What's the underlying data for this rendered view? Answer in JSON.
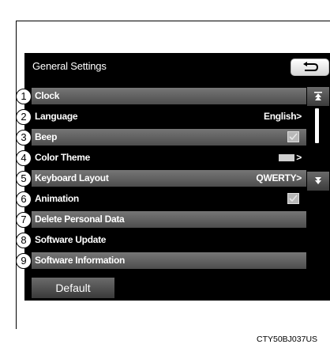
{
  "screen": {
    "title": "General Settings",
    "back_icon": "return-arrow-icon"
  },
  "items": [
    {
      "number": "1",
      "label": "Clock",
      "value": "",
      "highlighted": true
    },
    {
      "number": "2",
      "label": "Language",
      "value": "English",
      "value_suffix": ">",
      "highlighted": false
    },
    {
      "number": "3",
      "label": "Beep",
      "checked": true,
      "highlighted": true
    },
    {
      "number": "4",
      "label": "Color Theme",
      "value_suffix": ">",
      "swatch_color": "#cfcfcf",
      "highlighted": false
    },
    {
      "number": "5",
      "label": "Keyboard Layout",
      "value": "QWERTY",
      "value_suffix": ">",
      "highlighted": true
    },
    {
      "number": "6",
      "label": "Animation",
      "checked": true,
      "highlighted": false
    },
    {
      "number": "7",
      "label": "Delete Personal Data",
      "highlighted": true
    },
    {
      "number": "8",
      "label": "Software Update",
      "highlighted": false
    },
    {
      "number": "9",
      "label": "Software Information",
      "highlighted": true
    }
  ],
  "scroll": {
    "up_icon": "scroll-top-icon",
    "down_icon": "scroll-down-icon"
  },
  "default_button": {
    "label": "Default"
  },
  "caption": "CTY50BJ037US",
  "colors": {
    "screen_bg": "#000000",
    "row_highlight": "#5c5c5c",
    "text": "#ffffff"
  }
}
